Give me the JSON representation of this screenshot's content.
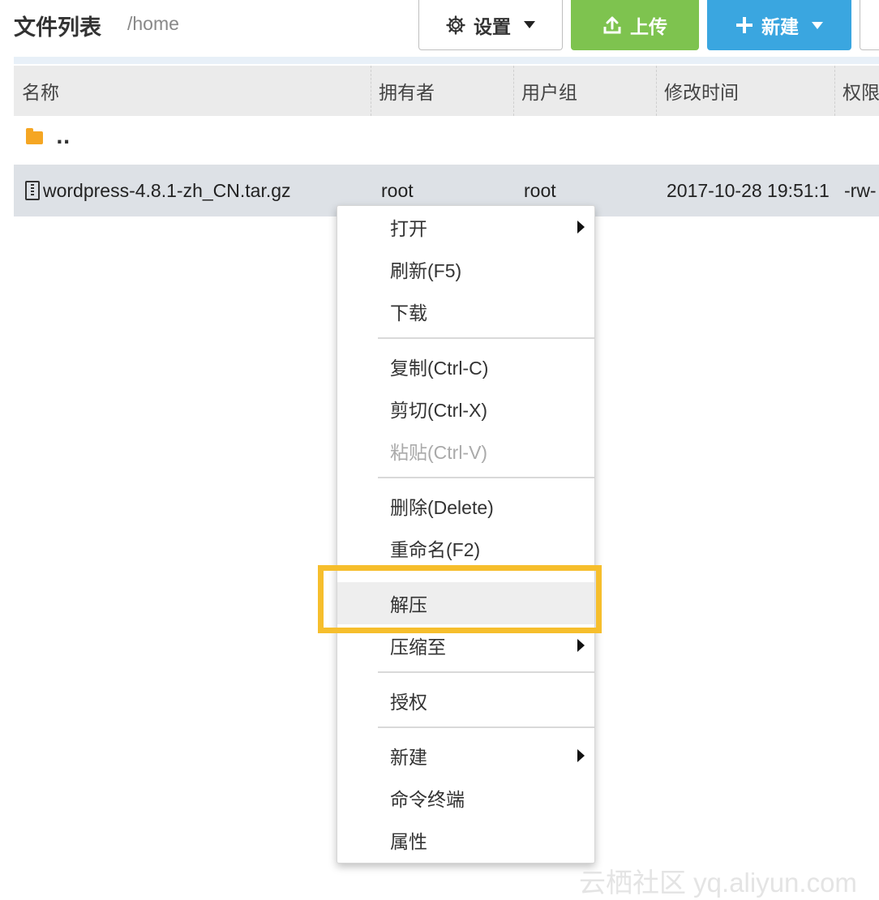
{
  "header": {
    "title": "文件列表",
    "breadcrumb": "/home",
    "settings_label": "设置",
    "upload_label": "上传",
    "new_label": "新建"
  },
  "table": {
    "columns": [
      "名称",
      "拥有者",
      "用户组",
      "修改时间",
      "权限"
    ],
    "parent_label": "..",
    "rows": [
      {
        "name": "wordpress-4.8.1-zh_CN.tar.gz",
        "owner": "root",
        "group": "root",
        "modified": "2017-10-28 19:51:1",
        "perm": "-rw-"
      }
    ]
  },
  "context_menu": {
    "items": [
      {
        "label": "打开",
        "submenu": true,
        "disabled": false
      },
      {
        "label": "刷新(F5)",
        "submenu": false,
        "disabled": false
      },
      {
        "label": "下载",
        "submenu": false,
        "disabled": false
      },
      {
        "label": "复制(Ctrl-C)",
        "submenu": false,
        "disabled": false
      },
      {
        "label": "剪切(Ctrl-X)",
        "submenu": false,
        "disabled": false
      },
      {
        "label": "粘贴(Ctrl-V)",
        "submenu": false,
        "disabled": true
      },
      {
        "label": "删除(Delete)",
        "submenu": false,
        "disabled": false
      },
      {
        "label": "重命名(F2)",
        "submenu": false,
        "disabled": false
      },
      {
        "label": "解压",
        "submenu": false,
        "disabled": false,
        "highlighted": true
      },
      {
        "label": "压缩至",
        "submenu": true,
        "disabled": false
      },
      {
        "label": "授权",
        "submenu": false,
        "disabled": false
      },
      {
        "label": "新建",
        "submenu": true,
        "disabled": false
      },
      {
        "label": "命令终端",
        "submenu": false,
        "disabled": false
      },
      {
        "label": "属性",
        "submenu": false,
        "disabled": false
      }
    ]
  },
  "watermark": "云栖社区 yq.aliyun.com",
  "colors": {
    "upload": "#7ec34f",
    "new": "#3aa6e0",
    "highlight": "#f6be2c",
    "folder": "#f5a623"
  },
  "icons": [
    "gear-icon",
    "upload-icon",
    "plus-icon",
    "folder-icon",
    "archive-file-icon",
    "chevron-down-icon",
    "chevron-right-icon"
  ]
}
